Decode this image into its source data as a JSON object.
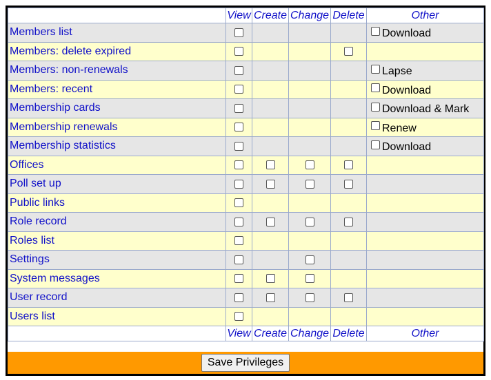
{
  "columns": [
    "View",
    "Create",
    "Change",
    "Delete",
    "Other"
  ],
  "save_label": "Save Privileges",
  "colors": {
    "link": "#1010c8",
    "row_gray": "#e6e6e6",
    "row_yellow": "#ffffcc",
    "footer": "#ff9900"
  },
  "rows": [
    {
      "name": "Members list",
      "view": true,
      "create": false,
      "change": false,
      "delete": false,
      "other": "Download"
    },
    {
      "name": "Members: delete expired",
      "view": true,
      "create": false,
      "change": false,
      "delete": true,
      "other": ""
    },
    {
      "name": "Members: non-renewals",
      "view": true,
      "create": false,
      "change": false,
      "delete": false,
      "other": "Lapse"
    },
    {
      "name": "Members: recent",
      "view": true,
      "create": false,
      "change": false,
      "delete": false,
      "other": "Download"
    },
    {
      "name": "Membership cards",
      "view": true,
      "create": false,
      "change": false,
      "delete": false,
      "other": "Download & Mark"
    },
    {
      "name": "Membership renewals",
      "view": true,
      "create": false,
      "change": false,
      "delete": false,
      "other": "Renew"
    },
    {
      "name": "Membership statistics",
      "view": true,
      "create": false,
      "change": false,
      "delete": false,
      "other": "Download"
    },
    {
      "name": "Offices",
      "view": true,
      "create": true,
      "change": true,
      "delete": true,
      "other": ""
    },
    {
      "name": "Poll set up",
      "view": true,
      "create": true,
      "change": true,
      "delete": true,
      "other": ""
    },
    {
      "name": "Public links",
      "view": true,
      "create": false,
      "change": false,
      "delete": false,
      "other": ""
    },
    {
      "name": "Role record",
      "view": true,
      "create": true,
      "change": true,
      "delete": true,
      "other": ""
    },
    {
      "name": "Roles list",
      "view": true,
      "create": false,
      "change": false,
      "delete": false,
      "other": ""
    },
    {
      "name": "Settings",
      "view": true,
      "create": false,
      "change": true,
      "delete": false,
      "other": ""
    },
    {
      "name": "System messages",
      "view": true,
      "create": true,
      "change": true,
      "delete": false,
      "other": ""
    },
    {
      "name": "User record",
      "view": true,
      "create": true,
      "change": true,
      "delete": true,
      "other": ""
    },
    {
      "name": "Users list",
      "view": true,
      "create": false,
      "change": false,
      "delete": false,
      "other": ""
    }
  ]
}
